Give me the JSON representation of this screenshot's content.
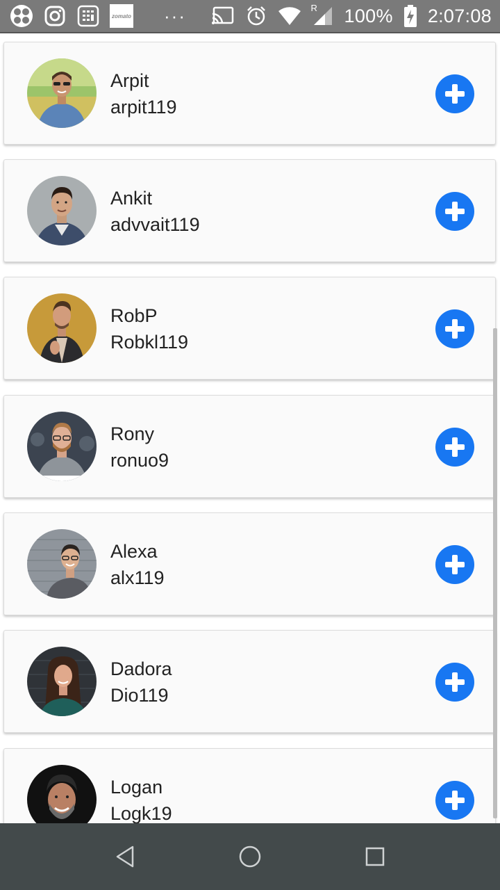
{
  "status_bar": {
    "battery": "100%",
    "time": "2:07:08",
    "zomato_label": "zomato",
    "signal_label": "R",
    "more": "···"
  },
  "icons": {
    "app1": "pinwheel-icon",
    "app2": "instagram-icon",
    "app3": "calculator-icon",
    "cast": "cast-icon",
    "alarm": "alarm-icon",
    "wifi": "wifi-icon",
    "signal": "signal-icon",
    "battery": "battery-charging-icon",
    "add": "plus-icon",
    "back": "back-triangle-icon",
    "home": "home-circle-icon",
    "recents": "recents-square-icon"
  },
  "users": [
    {
      "name": "Arpit",
      "handle": "arpit119"
    },
    {
      "name": "Ankit",
      "handle": "advvait119"
    },
    {
      "name": "RobP",
      "handle": "Robkl119"
    },
    {
      "name": "Rony",
      "handle": "ronuo9"
    },
    {
      "name": "Alexa",
      "handle": "alx119"
    },
    {
      "name": "Dadora",
      "handle": "Dio119"
    },
    {
      "name": "Logan",
      "handle": "Logk19"
    }
  ],
  "colors": {
    "accent": "#1877f2",
    "status_bar": "#7a7a7a",
    "nav_bar": "#434a4b"
  }
}
